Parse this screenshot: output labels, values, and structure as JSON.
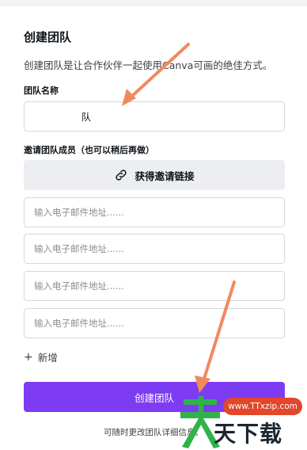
{
  "form": {
    "title": "创建团队",
    "description": "创建团队是让合作伙伴一起使用Canva可画的绝佳方式。",
    "team_name_label": "团队名称",
    "team_name_value": "队",
    "invite_label": "邀请团队成员（也可以稍后再做）",
    "invite_link_button": "获得邀请链接",
    "email_placeholder": "输入电子邮件地址......",
    "add_more": "新增",
    "create_button": "创建团队",
    "footer_note": "可随时更改团队详细信息。"
  },
  "icons": {
    "invite_link": "link-icon",
    "add": "plus-icon"
  },
  "colors": {
    "primary": "#7d3cf2",
    "annotation_arrow": "#f08a5d",
    "watermark_green": "#2fb34a",
    "watermark_red": "#e2462b"
  },
  "watermark": {
    "pill": "www.TTxzip.com",
    "brand": "天下载"
  }
}
